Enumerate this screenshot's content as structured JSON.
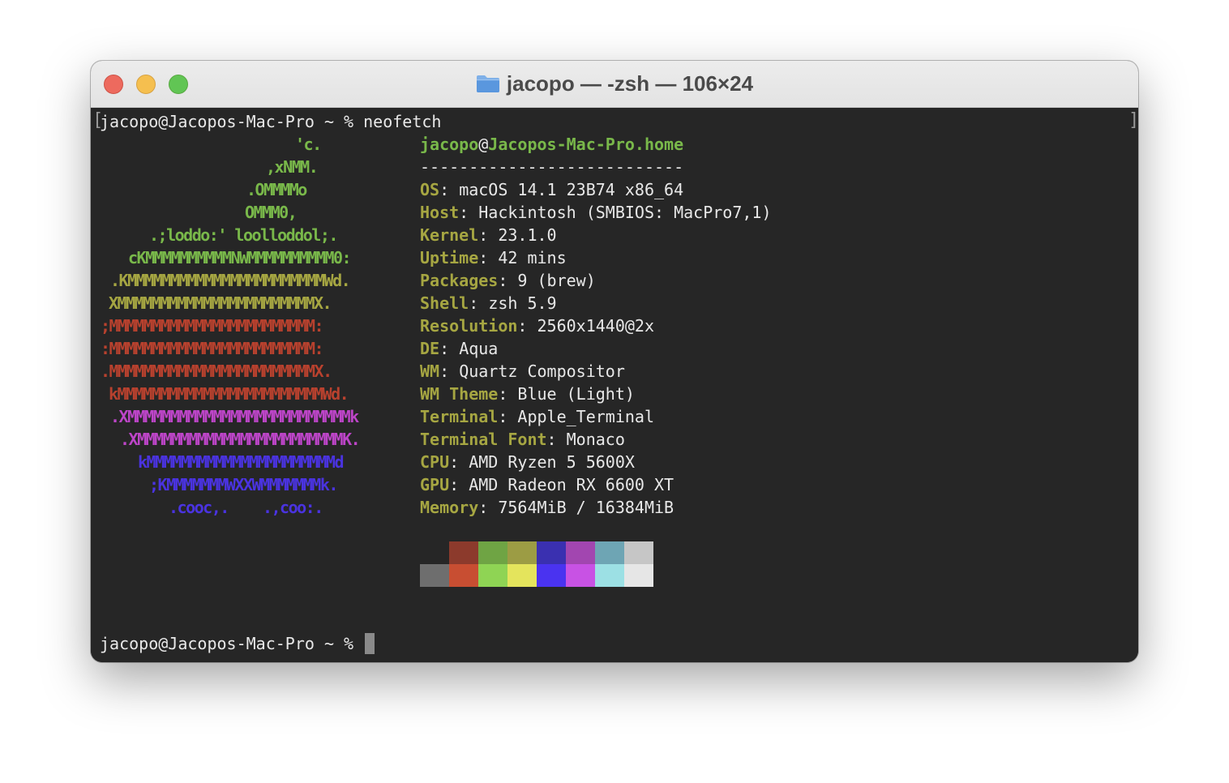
{
  "window": {
    "title": "jacopo — -zsh — 106×24",
    "folder_icon": "folder-icon"
  },
  "terminal": {
    "command_prompt": "jacopo@Jacopos-Mac-Pro ~ % ",
    "command": "neofetch",
    "final_prompt": "jacopo@Jacopos-Mac-Pro ~ % ",
    "left_bracket": "[",
    "right_bracket": "]"
  },
  "ascii_art": [
    {
      "text": "'c.",
      "color": "#79b84a"
    },
    {
      "text": ",xNMM.",
      "color": "#79b84a"
    },
    {
      "text": ".OMMMMo",
      "color": "#79b84a"
    },
    {
      "text": "OMMM0,",
      "color": "#79b84a"
    },
    {
      "text": ".;loddo:' loolloddol;.",
      "color": "#79b84a"
    },
    {
      "text": "cKMMMMMMMMMMNWMMMMMMMMMM0:",
      "color": "#79b84a"
    },
    {
      "text": ".KMMMMMMMMMMMMMMMMMMMMMMMWd.",
      "color": "#a6a642"
    },
    {
      "text": "XMMMMMMMMMMMMMMMMMMMMMMMX.",
      "color": "#a6a642"
    },
    {
      "text": ";MMMMMMMMMMMMMMMMMMMMMMMM:",
      "color": "#b8412e"
    },
    {
      "text": ":MMMMMMMMMMMMMMMMMMMMMMMM:",
      "color": "#b8412e"
    },
    {
      "text": ".MMMMMMMMMMMMMMMMMMMMMMMMX.",
      "color": "#b8412e"
    },
    {
      "text": "kMMMMMMMMMMMMMMMMMMMMMMMMWd.",
      "color": "#b8412e"
    },
    {
      "text": ".XMMMMMMMMMMMMMMMMMMMMMMMMMMk",
      "color": "#bd45c8"
    },
    {
      "text": ".XMMMMMMMMMMMMMMMMMMMMMMMMK.",
      "color": "#bd45c8"
    },
    {
      "text": "kMMMMMMMMMMMMMMMMMMMMMMd",
      "color": "#4a33e0"
    },
    {
      "text": ";KMMMMMMMWXXWMMMMMMMk.",
      "color": "#4a33e0"
    },
    {
      "text": ".cooc,.    .,coo:.",
      "color": "#4a33e0"
    }
  ],
  "info": {
    "user": "jacopo",
    "at": "@",
    "host": "Jacopos-Mac-Pro.home",
    "separator": "---------------------------",
    "fields": [
      {
        "key": "OS",
        "value": "macOS 14.1 23B74 x86_64"
      },
      {
        "key": "Host",
        "value": "Hackintosh (SMBIOS: MacPro7,1)"
      },
      {
        "key": "Kernel",
        "value": "23.1.0"
      },
      {
        "key": "Uptime",
        "value": "42 mins"
      },
      {
        "key": "Packages",
        "value": "9 (brew)"
      },
      {
        "key": "Shell",
        "value": "zsh 5.9"
      },
      {
        "key": "Resolution",
        "value": "2560x1440@2x"
      },
      {
        "key": "DE",
        "value": "Aqua"
      },
      {
        "key": "WM",
        "value": "Quartz Compositor"
      },
      {
        "key": "WM Theme",
        "value": "Blue (Light)"
      },
      {
        "key": "Terminal",
        "value": "Apple_Terminal"
      },
      {
        "key": "Terminal Font",
        "value": "Monaco"
      },
      {
        "key": "CPU",
        "value": "AMD Ryzen 5 5600X"
      },
      {
        "key": "GPU",
        "value": "AMD Radeon RX 6600 XT"
      },
      {
        "key": "Memory",
        "value": "7564MiB / 16384MiB"
      }
    ],
    "key_value_separator": ": "
  },
  "palette": {
    "normal": [
      "#262626",
      "#8c3a2c",
      "#6fa444",
      "#9c9c44",
      "#3a30b0",
      "#a246b0",
      "#6ea5b4",
      "#c6c6c6"
    ],
    "bright": [
      "#6e6e6e",
      "#c84e32",
      "#8fd454",
      "#e4e45c",
      "#4a33f0",
      "#c852e4",
      "#9ce0e4",
      "#e6e6e6"
    ]
  }
}
